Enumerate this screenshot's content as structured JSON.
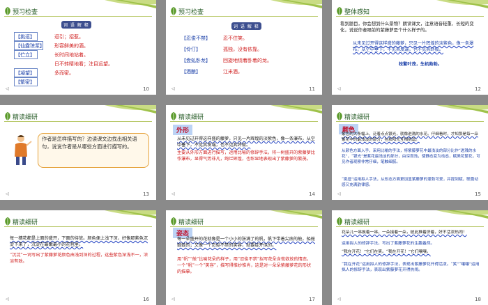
{
  "slides": [
    {
      "title": "预习检查",
      "page": "10",
      "terms": [
        {
          "term": "【挑逗】",
          "defn": "逗引；招惹。"
        },
        {
          "term": "【仙露琼浆】",
          "defn": "形容鲜美的酒。"
        },
        {
          "term": "【伫立】",
          "defn": "长时间地站着。"
        },
        {
          "term": "【忍俊不禁】",
          "defn": "日不转睛地看；注目远望。"
        },
        {
          "term": "【凝望】",
          "defn": "多而密。"
        },
        {
          "term": "【繁密】",
          "defn": ""
        }
      ]
    },
    {
      "title": "预习检查",
      "page": "11",
      "terms": [
        {
          "term": "【忍俊不禁】",
          "defn": "忍不住笑。"
        },
        {
          "term": "【伶仃】",
          "defn": "孤独，没有依靠。"
        },
        {
          "term": "【盘虬卧龙】",
          "defn": "回旋地绕着卧着的龙。"
        },
        {
          "term": "【酒酿】",
          "defn": "江米酒。"
        }
      ]
    },
    {
      "title": "整体感知",
      "page": "12",
      "question": "看到题目，你会想到什么景物？朗读课文，注意语音轻重、长短的变化，说说作者眼前的紫藤萝是个什么样子的。",
      "quote": "从未见过开得这样盛的藤萝，只见一片辉煌的淡紫色，像一条瀑布，从空中垂下，不见其发端，也不见其终极。",
      "answer": "枝繁叶茂，生机勃勃。"
    },
    {
      "title": "精读细研",
      "page": "13",
      "bubble": "作者是怎样描写的？边读课文边找出相关语句，说说作者是从哪些方面进行描写的。"
    },
    {
      "title": "精读细研",
      "page": "14",
      "tag": "外形",
      "quote": "从未见过开得这样盛的藤萝，只见一片辉煌的淡紫色，像一条瀑布，从空中垂下，不见其发端，也不见其终极。",
      "analysis": "主要从外形方面进行描写，运用比喻的修辞手法，将一树盛开的紫藤萝比作瀑布，显得气势非凡，绚烂辉煌，也彰显地表现出了紫藤萝的繁茂。"
    },
    {
      "title": "精读细研",
      "page": "15",
      "tag": "颜色",
      "quote": "紫色的大条幅上，泛着点点银光，就像迸溅的水花。仔细看时，才知那是每一朵紫花中的最浅淡的部分，在和阳光互相挑逗。",
      "analysis": "从颜色方面入手，采用比喻的手法，将紫藤萝花中最浅淡的部分比作“迸溅的水花”，“银光”是紫花最浅淡的部分，由深而浅，使静态变为动态，赋美花繁花，可见作者观察非常仔细，笔触细腻。",
      "analysis2": "“挑逗”运用拟人手法，从形态方面更加显紫藤萝的蓬勃可爱，并提到赋，联篇动感又充满韵律感。"
    },
    {
      "title": "精读细研",
      "page": "16",
      "quote": "每一穗花都是上面的盛开，下面的待放。颜色便上浅下深，好像那紫色沉淀下来了，沉淀在最嫩最小的花苞里。",
      "analysis": "“沉淀”一词写出了紫藤萝花颜色由浅到深的过程，这些紫色深浅不一，浓淡有致。"
    },
    {
      "title": "精读细研",
      "page": "17",
      "tag": "姿态",
      "quote": "每一朵盛开的花就像是一个小小的张满了的帆，帆下带着尖底的舱，船舱鼓鼓的；又像一个忍俊不禁的笑容，就要绽开似的。",
      "analysis": "用“帆”“舱”比喻花朵的样子，用“忍俊不禁”拟写花朵含苞欲放的情态，一个“帆”一个“笑容”，描写得惟妙惟肖，这是对一朵朵紫藤萝花的形状的描摹。"
    },
    {
      "title": "精读细研",
      "page": "18",
      "quote": "花朵儿一串挨着一串，一朵接着一朵，彼此推着挤着，好不活泼热闹！",
      "analysis": "运用拟人的修辞手法，写出了紫藤萝花的生趣盎然。",
      "quote2": "“我在开花！”它们在笑。“我在开花！”它们嚷嚷。",
      "analysis2": "“我在开花”运用拟人的修辞手法，表现出紫藤萝花开得活泼。“笑”“嚷嚷”运用拟人的修辞手法，表现出紫藤萝花开得热闹。"
    }
  ],
  "colors": {
    "header_green": "#8bb53a",
    "accent_red": "#d02020",
    "accent_blue": "#1a3fa8"
  }
}
